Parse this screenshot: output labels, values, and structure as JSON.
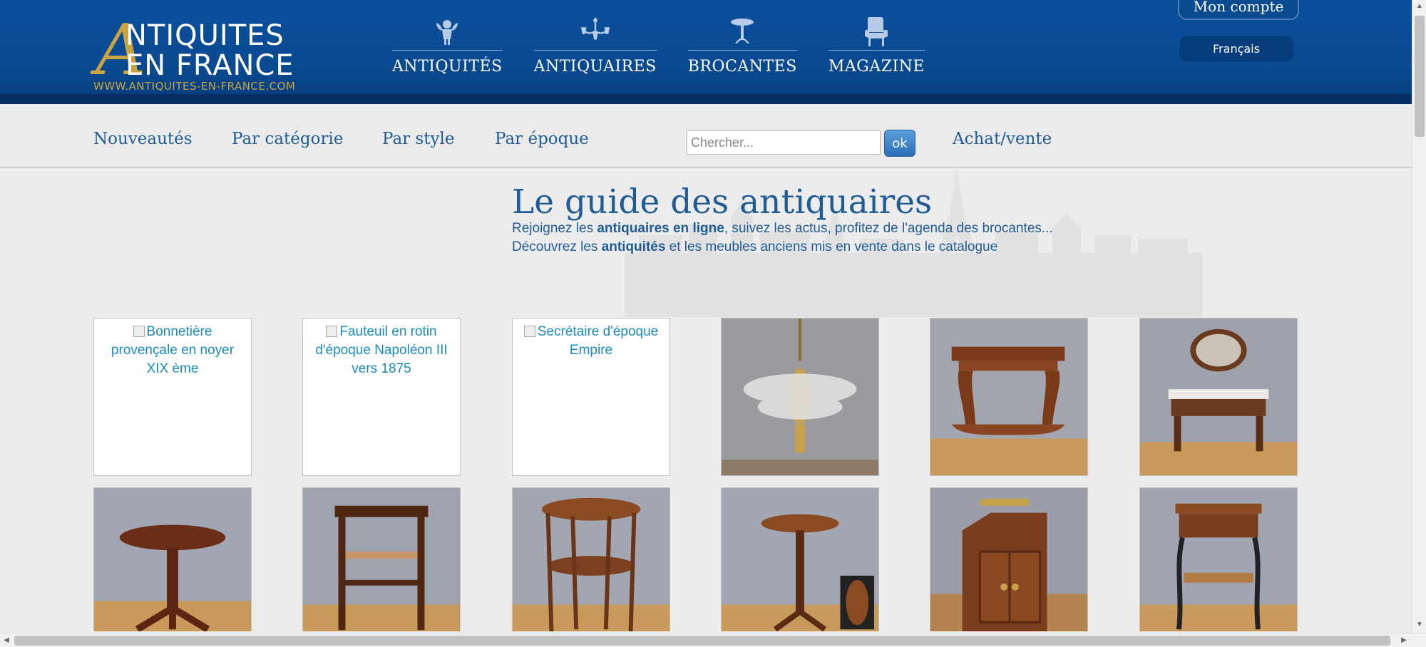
{
  "header": {
    "logo": {
      "letter": "A",
      "line1": "NTIQUITES",
      "line2": "EN FRANCE",
      "url": "WWW.ANTIQUITES-EN-FRANCE.COM"
    },
    "nav": [
      {
        "label": "ANTIQUITÉS",
        "icon": "cherub-icon"
      },
      {
        "label": "ANTIQUAIRES",
        "icon": "chandelier-icon"
      },
      {
        "label": "BROCANTES",
        "icon": "table-icon"
      },
      {
        "label": "MAGAZINE",
        "icon": "armchair-icon"
      }
    ],
    "account_label": "Mon compte",
    "language": "Français"
  },
  "subnav": {
    "links": [
      "Nouveautés",
      "Par catégorie",
      "Par style",
      "Par époque"
    ],
    "search_placeholder": "Chercher...",
    "ok_label": "ok",
    "achat_vente": "Achat/vente"
  },
  "hero": {
    "title": "Le guide des antiquaires",
    "line1_pre": "Rejoignez les ",
    "line1_bold": "antiquaires en ligne",
    "line1_post": ", suivez les actus, profitez de l'agenda des brocantes...",
    "line2_pre": "Découvrez les ",
    "line2_bold": "antiquités",
    "line2_post": " et les meubles anciens mis en vente dans le catalogue"
  },
  "products": {
    "row1": [
      {
        "alt": "Bonnetière provençale en noyer XIX ème",
        "image": "broken"
      },
      {
        "alt": "Fauteuil en rotin d'époque Napoléon III vers 1875",
        "image": "broken"
      },
      {
        "alt": "Secrétaire d'époque Empire",
        "image": "broken"
      },
      {
        "image": "chandelier-photo"
      },
      {
        "image": "console-photo"
      },
      {
        "image": "vanity-photo"
      }
    ],
    "row2": [
      {
        "image": "pedestal-table-photo"
      },
      {
        "image": "side-table-photo"
      },
      {
        "image": "tea-table-photo"
      },
      {
        "image": "tilt-table-photo"
      },
      {
        "image": "coal-box-photo"
      },
      {
        "image": "work-table-photo"
      }
    ]
  },
  "colors": {
    "header_blue": "#0a4a91",
    "gold": "#c9a443",
    "link_blue": "#1f5b94",
    "alt_text_blue": "#1a8bbf"
  }
}
